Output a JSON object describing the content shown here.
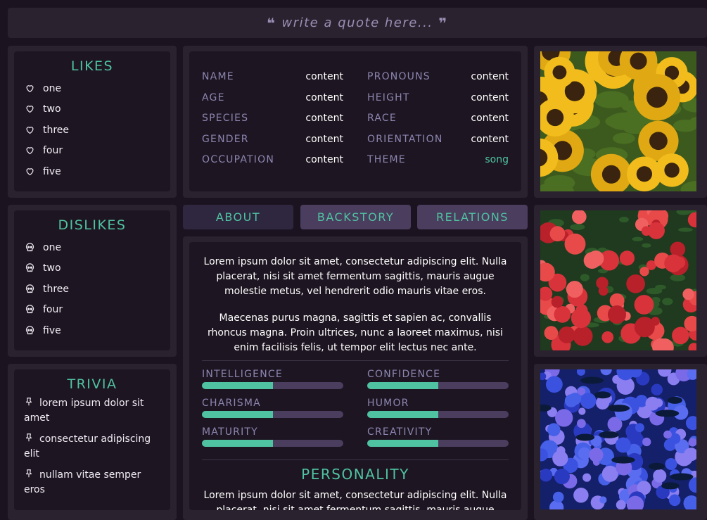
{
  "quote": {
    "text": "write a quote here..."
  },
  "likes": {
    "title": "LIKES",
    "items": [
      "one",
      "two",
      "three",
      "four",
      "five"
    ]
  },
  "dislikes": {
    "title": "DISLIKES",
    "items": [
      "one",
      "two",
      "three",
      "four",
      "five"
    ]
  },
  "trivia": {
    "title": "TRIVIA",
    "items": [
      "lorem ipsum dolor sit amet",
      "consectetur adipiscing elit",
      "nullam vitae semper eros"
    ]
  },
  "info": {
    "left": [
      {
        "label": "NAME",
        "value": "content"
      },
      {
        "label": "AGE",
        "value": "content"
      },
      {
        "label": "SPECIES",
        "value": "content"
      },
      {
        "label": "GENDER",
        "value": "content"
      },
      {
        "label": "OCCUPATION",
        "value": "content"
      }
    ],
    "right": [
      {
        "label": "PRONOUNS",
        "value": "content"
      },
      {
        "label": "HEIGHT",
        "value": "content"
      },
      {
        "label": "RACE",
        "value": "content"
      },
      {
        "label": "ORIENTATION",
        "value": "content"
      },
      {
        "label": "THEME",
        "value": "song"
      }
    ]
  },
  "tabs": [
    {
      "label": "ABOUT",
      "state": "inactive"
    },
    {
      "label": "BACKSTORY",
      "state": "active"
    },
    {
      "label": "RELATIONS",
      "state": "active"
    }
  ],
  "about": {
    "paragraph1": "Lorem ipsum dolor sit amet, consectetur adipiscing elit. Nulla placerat, nisi sit amet fermentum sagittis, mauris augue molestie metus, vel hendrerit odio mauris vitae eros.",
    "paragraph2": "Maecenas purus magna, sagittis et sapien ac, convallis rhoncus magna. Proin ultrices, nunc a laoreet maximus, nisi enim facilisis felis, ut tempor elit lectus nec ante.",
    "personality_title": "PERSONALITY",
    "personality_text": "Lorem ipsum dolor sit amet, consectetur adipiscing elit. Nulla placerat, nisi sit amet fermentum sagittis, mauris augue"
  },
  "stats": [
    {
      "name": "INTELLIGENCE",
      "value": 0.5
    },
    {
      "name": "CONFIDENCE",
      "value": 0.5
    },
    {
      "name": "CHARISMA",
      "value": 0.5
    },
    {
      "name": "HUMOR",
      "value": 0.5
    },
    {
      "name": "MATURITY",
      "value": 0.5
    },
    {
      "name": "CREATIVITY",
      "value": 0.5
    }
  ],
  "colors": {
    "accent": "#4fc3a1",
    "label": "#8c86b0",
    "panel": "#2b2230",
    "inner": "#1d1521",
    "background": "#1b1420"
  },
  "icons": {
    "likes": "heart-icon",
    "dislikes": "skull-icon",
    "trivia": "pin-icon",
    "quote_open": "open-quote-icon",
    "quote_close": "close-quote-icon"
  },
  "images": [
    "sunflowers-photo",
    "red-flowers-photo",
    "blue-hydrangea-photo"
  ]
}
